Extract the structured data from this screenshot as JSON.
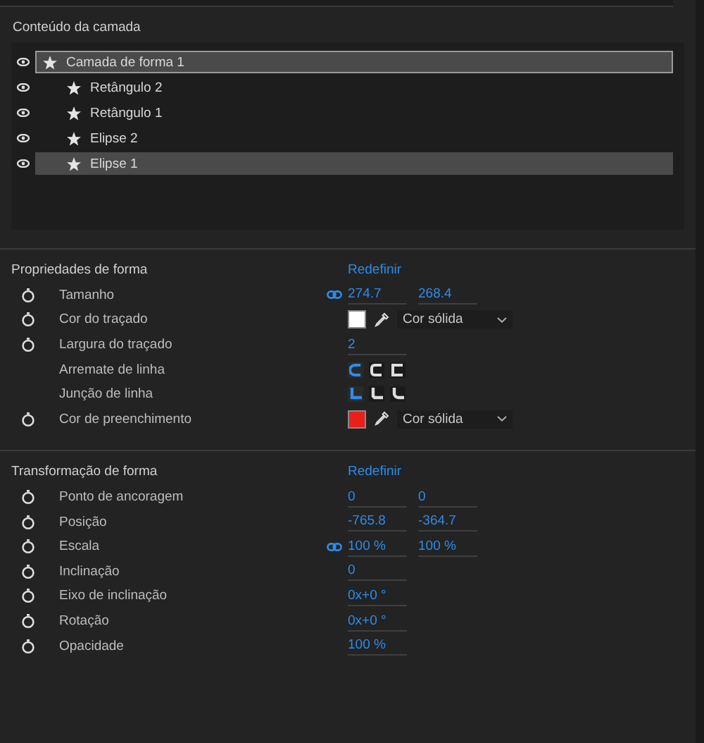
{
  "layer_contents": {
    "title": "Conteúdo da camada",
    "items": [
      {
        "label": "Camada de forma 1",
        "visible": true,
        "selected": true,
        "focused": true,
        "children": [
          {
            "label": "Retângulo 2",
            "visible": true,
            "selected": false,
            "focused": false
          },
          {
            "label": "Retângulo 1",
            "visible": true,
            "selected": false,
            "focused": false
          },
          {
            "label": "Elipse 2",
            "visible": true,
            "selected": false,
            "focused": false
          },
          {
            "label": "Elipse 1",
            "visible": true,
            "selected": true,
            "focused": false
          }
        ]
      }
    ]
  },
  "sections": [
    {
      "title": "Propriedades de forma",
      "reset": "Redefinir",
      "rows": [
        {
          "kind": "pair",
          "label": "Tamanho",
          "animatable": true,
          "linked": true,
          "values": [
            "274.7",
            "268.4"
          ]
        },
        {
          "kind": "color",
          "label": "Cor do traçado",
          "animatable": true,
          "color": "#ffffff",
          "fill_type": "Cor sólida"
        },
        {
          "kind": "pair",
          "label": "Largura do traçado",
          "animatable": true,
          "values": [
            "2"
          ]
        },
        {
          "kind": "caps",
          "label": "Arremate de linha",
          "options": [
            {
              "selected": true
            },
            {
              "selected": false
            },
            {
              "selected": false
            }
          ]
        },
        {
          "kind": "joins",
          "label": "Junção de linha",
          "options": [
            {
              "selected": true
            },
            {
              "selected": false
            },
            {
              "selected": false
            }
          ]
        },
        {
          "kind": "color",
          "label": "Cor de preenchimento",
          "animatable": true,
          "color": "#e8201c",
          "fill_type": "Cor sólida"
        }
      ]
    },
    {
      "title": "Transformação de forma",
      "reset": "Redefinir",
      "rows": [
        {
          "kind": "pair",
          "label": "Ponto de ancoragem",
          "animatable": true,
          "values": [
            "0",
            "0"
          ]
        },
        {
          "kind": "pair",
          "label": "Posição",
          "animatable": true,
          "values": [
            "-765.8",
            "-364.7"
          ]
        },
        {
          "kind": "pair",
          "label": "Escala",
          "animatable": true,
          "linked": true,
          "values": [
            "100 %",
            "100 %"
          ]
        },
        {
          "kind": "pair",
          "label": "Inclinação",
          "animatable": true,
          "values": [
            "0"
          ]
        },
        {
          "kind": "pair",
          "label": "Eixo de inclinação",
          "animatable": true,
          "values": [
            "0x+0 °"
          ]
        },
        {
          "kind": "pair",
          "label": "Rotação",
          "animatable": true,
          "values": [
            "0x+0 °"
          ]
        },
        {
          "kind": "pair",
          "label": "Opacidade",
          "animatable": true,
          "values": [
            "100 %"
          ]
        }
      ]
    }
  ]
}
